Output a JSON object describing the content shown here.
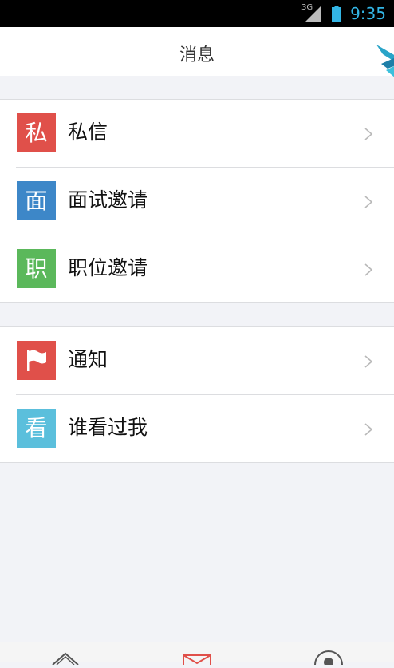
{
  "status_bar": {
    "network": "3G",
    "time": "9:35"
  },
  "header": {
    "title": "消息"
  },
  "groups": [
    {
      "items": [
        {
          "icon_char": "私",
          "label": "私信",
          "color": "#e0504a"
        },
        {
          "icon_char": "面",
          "label": "面试邀请",
          "color": "#3d87c8"
        },
        {
          "icon_char": "职",
          "label": "职位邀请",
          "color": "#5bb85b"
        }
      ]
    },
    {
      "items": [
        {
          "icon": "flag-icon",
          "label": "通知",
          "color": "#e0504a"
        },
        {
          "icon_char": "看",
          "label": "谁看过我",
          "color": "#5bbfdc"
        }
      ]
    }
  ],
  "tabbar": {
    "tabs": [
      {
        "icon": "home-icon",
        "active": false
      },
      {
        "icon": "mail-icon",
        "active": true
      },
      {
        "icon": "profile-icon",
        "active": false
      }
    ],
    "active_color": "#e0504a"
  }
}
